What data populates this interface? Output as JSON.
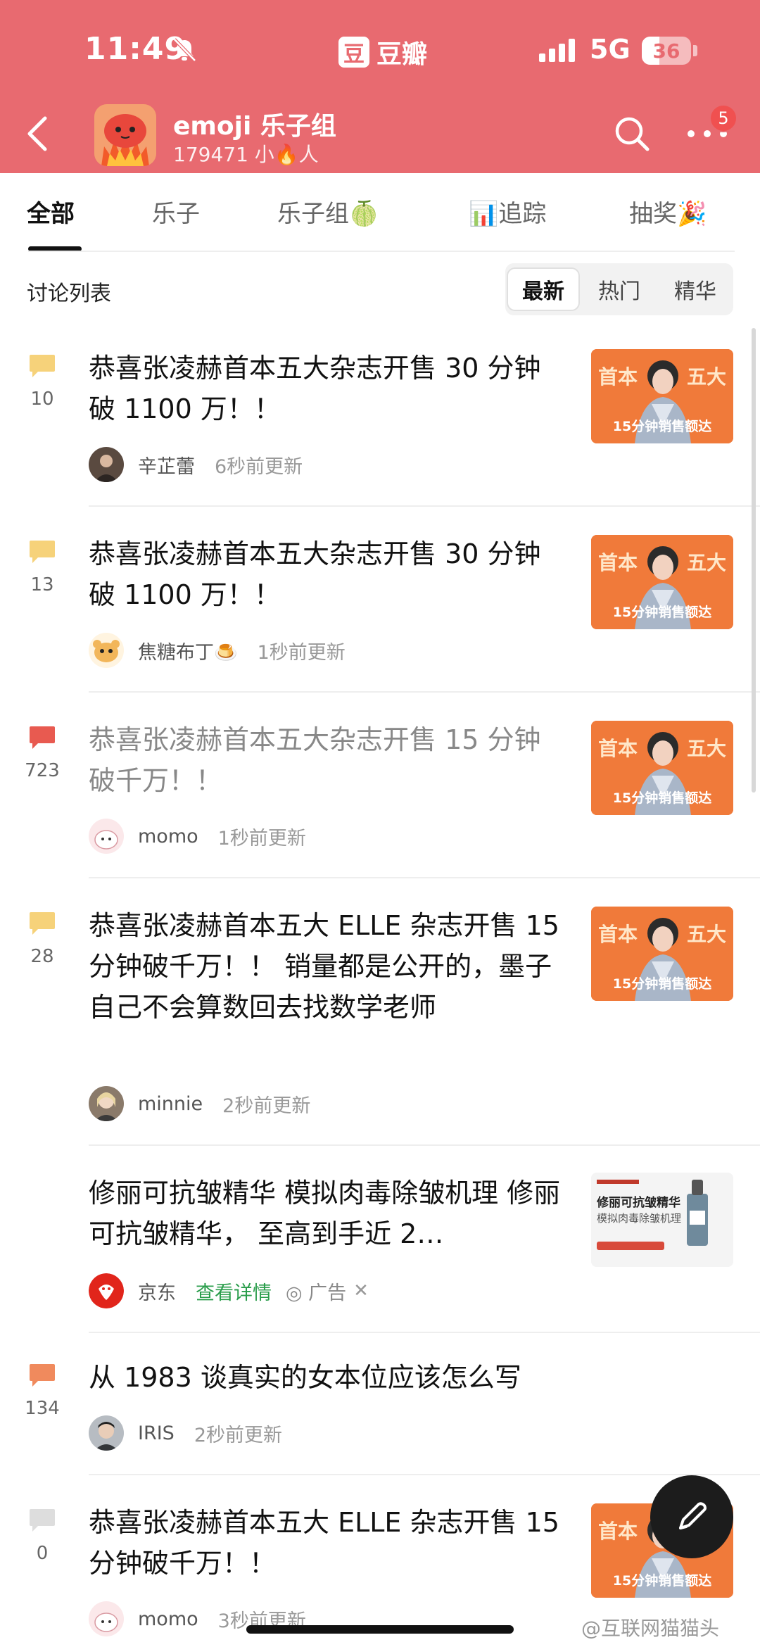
{
  "status_bar": {
    "time": "11:49",
    "app_name": "豆瓣",
    "app_logo_char": "豆",
    "network": "5G",
    "battery": "36",
    "battery_level": 0.36
  },
  "header": {
    "title": "emoji 乐子组",
    "member_count": "179471 小🔥人",
    "more_badge": "5"
  },
  "tabs": [
    {
      "label": "全部"
    },
    {
      "label": "乐子"
    },
    {
      "label": "乐子组🍈"
    },
    {
      "label": "📊追踪"
    },
    {
      "label": "抽奖🎉"
    }
  ],
  "list_header": "讨论列表",
  "sort_options": [
    {
      "label": "最新"
    },
    {
      "label": "热门"
    },
    {
      "label": "精华"
    }
  ],
  "thumb_text": {
    "left": "首本",
    "right": "五大",
    "caption": "15分钟销售额达"
  },
  "posts": [
    {
      "title": "恭喜张凌赫首本五大杂志开售 30 分钟破 1100 万！！",
      "comments": "10",
      "author": "辛芷蕾",
      "time": "6秒前更新"
    },
    {
      "title": "恭喜张凌赫首本五大杂志开售 30 分钟破 1100 万！！",
      "comments": "13",
      "author": "焦糖布丁🍮",
      "time": "1秒前更新"
    },
    {
      "title": "恭喜张凌赫首本五大杂志开售 15 分钟破千万！！",
      "comments": "723",
      "author": "momo",
      "time": "1秒前更新"
    },
    {
      "title": "恭喜张凌赫首本五大 ELLE 杂志开售 15 分钟破千万！！ 销量都是公开的，墨子自己不会算数回去找数学老师",
      "comments": "28",
      "author": "minnie",
      "time": "2秒前更新"
    },
    {
      "title": "修丽可抗皱精华 模拟肉毒除皱机理 修丽可抗皱精华， 至高到手近 2…",
      "author": "京东",
      "ad_link": "查看详情",
      "ad_label": "广告",
      "ad_close": "✕",
      "ad_image_lines": [
        "修丽可抗皱精华",
        "模拟肉毒除皱机理"
      ]
    },
    {
      "title": "从 1983 谈真实的女本位应该怎么写",
      "comments": "134",
      "author": "IRIS",
      "time": "2秒前更新"
    },
    {
      "title": "恭喜张凌赫首本五大 ELLE 杂志开售 15 分钟破千万！！",
      "comments": "0",
      "author": "momo",
      "time": "3秒前更新"
    }
  ],
  "watermark": "@互联网猫猫头",
  "colors": {
    "header_bg": "#e86a70",
    "comment_low": "#f6d27a",
    "comment_mid": "#f08a5d",
    "comment_hot": "#e85a50",
    "comment_none": "#dddddd",
    "ad_link": "#2a9d4b"
  }
}
